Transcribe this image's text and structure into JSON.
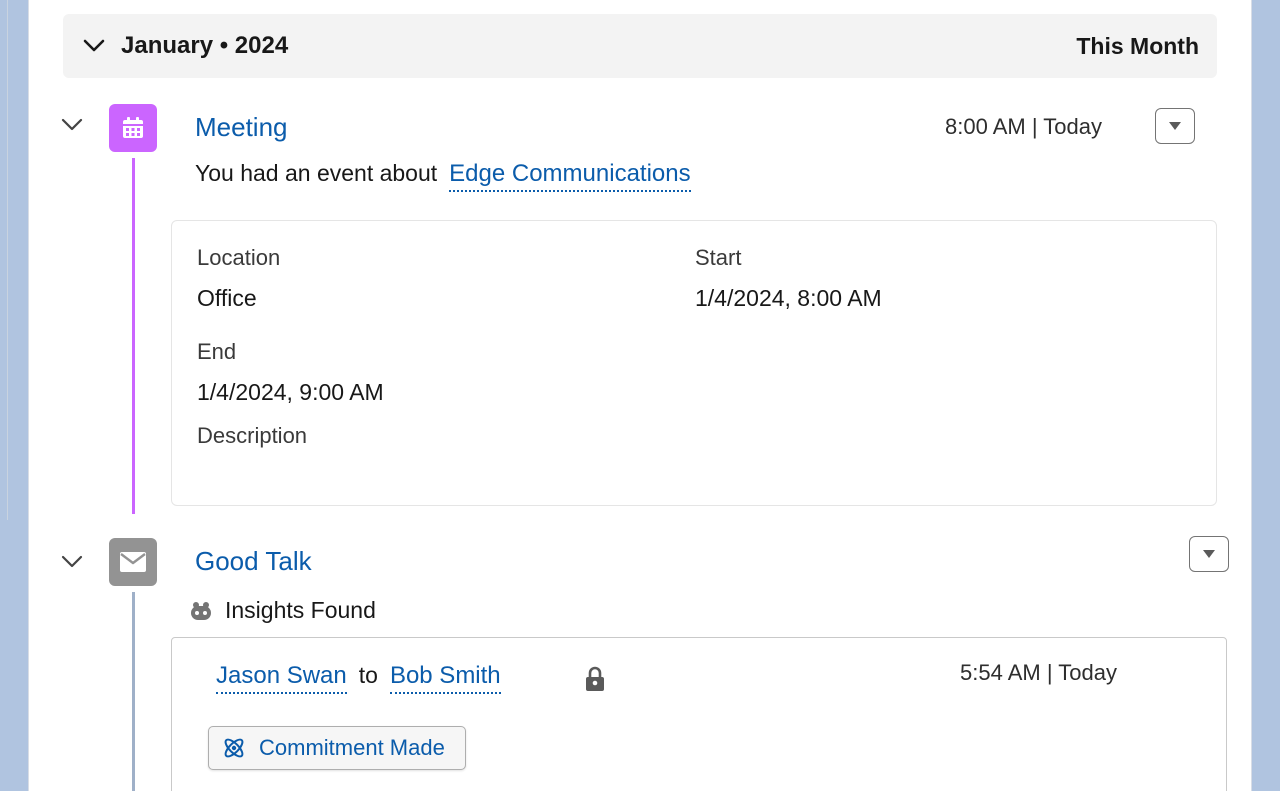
{
  "month_group": {
    "title": "January • 2024",
    "right_label": "This Month"
  },
  "meeting": {
    "icon": "calendar-icon",
    "title": "Meeting",
    "meta": "8:00 AM | Today",
    "subtitle_prefix": "You had an event about",
    "related_record": "Edge Communications",
    "fields": {
      "location_label": "Location",
      "location_value": "Office",
      "start_label": "Start",
      "start_value": "1/4/2024, 8:00 AM",
      "end_label": "End",
      "end_value": "1/4/2024, 9:00 AM",
      "description_label": "Description"
    }
  },
  "email": {
    "icon": "email-icon",
    "title": "Good Talk",
    "insights_label": "Insights Found",
    "from": "Jason Swan",
    "to_word": "to",
    "to": "Bob Smith",
    "meta": "5:54 AM | Today",
    "commitment_label": "Commitment Made"
  },
  "colors": {
    "link": "#0b5cab",
    "event": "#cb65ff",
    "email": "#939393"
  }
}
